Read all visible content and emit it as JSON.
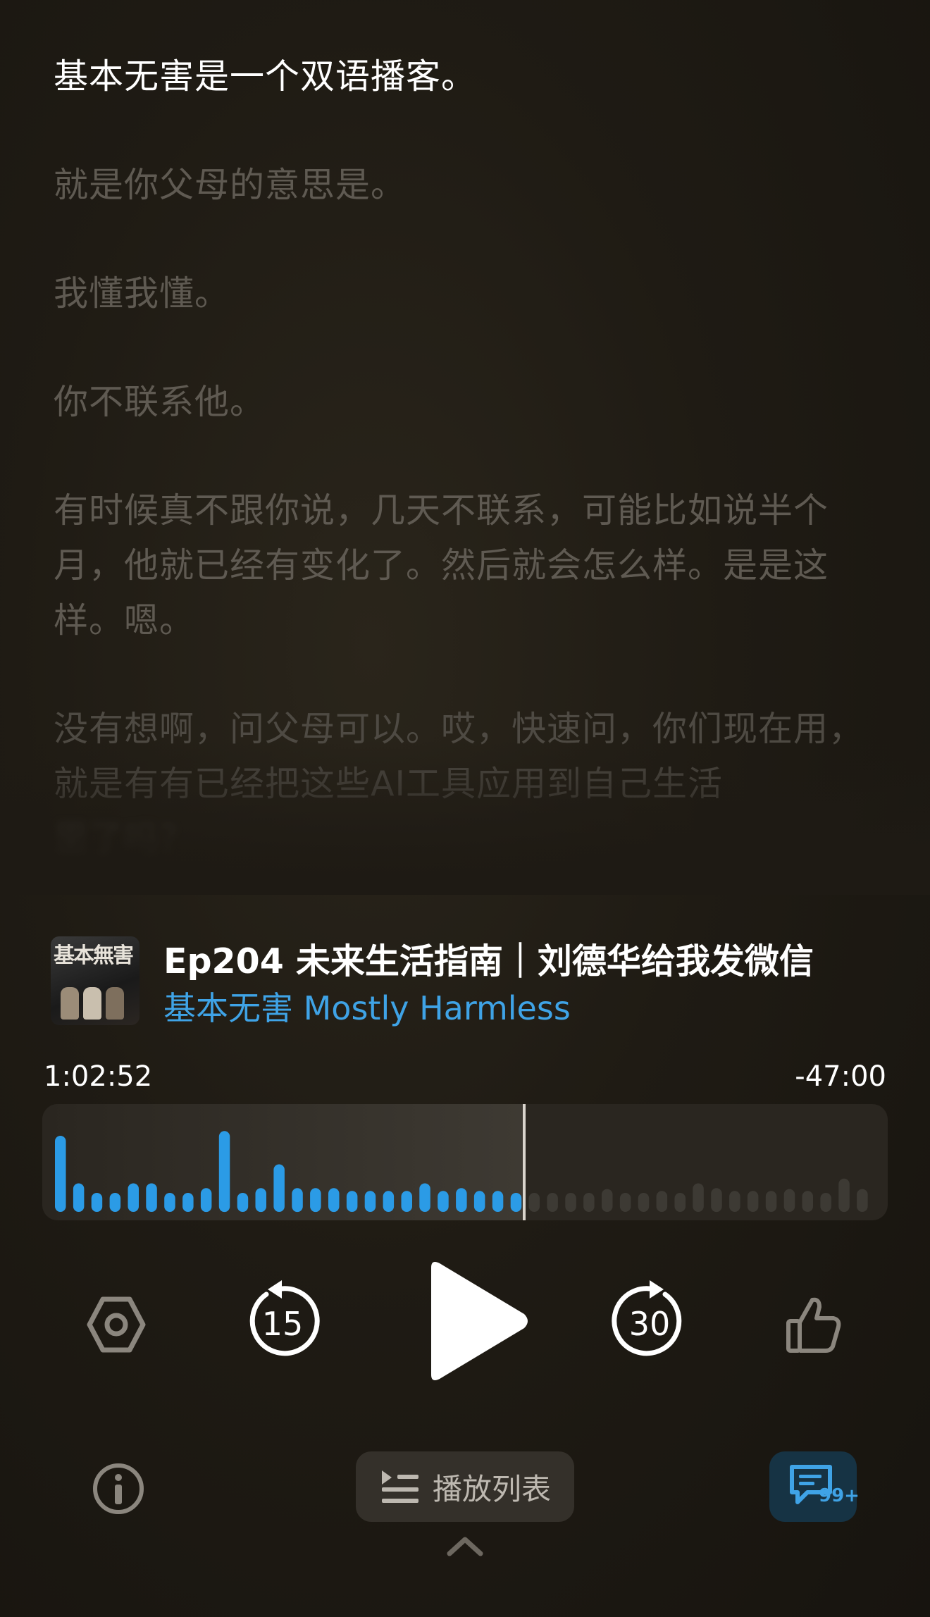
{
  "transcript": [
    {
      "text": "基本无害是一个双语播客。",
      "state": "active"
    },
    {
      "text": "就是你父母的意思是。",
      "state": "dim"
    },
    {
      "text": "我懂我懂。",
      "state": "dim"
    },
    {
      "text": "你不联系他。",
      "state": "dim"
    },
    {
      "text": "有时候真不跟你说，几天不联系，可能比如说半个月，他就已经有变化了。然后就会怎么样。是是这样。嗯。",
      "state": "dim"
    },
    {
      "text": "没有想啊，问父母可以。哎，快速问，你们现在用，就是有有已经把这些AI工具应用到自己生活",
      "state": "fade"
    },
    {
      "text": "里了吗？",
      "state": "blur"
    }
  ],
  "episode": {
    "title": "Ep204 未来生活指南｜刘德华给我发微信",
    "show": "基本无害 Mostly Harmless",
    "cover_text": "基本無害",
    "cover_icon": "podcast-cover-art"
  },
  "player": {
    "elapsed": "1:02:52",
    "remaining": "-47:00",
    "progress_fraction": 0.57,
    "rewind_label": "15",
    "forward_label": "30",
    "accent_color": "#3fa3e6",
    "played_bar_color": "#2b9be6",
    "unplayed_bar_color": "#3d3a34",
    "waveform_levels": [
      0.8,
      0.3,
      0.2,
      0.2,
      0.3,
      0.3,
      0.2,
      0.2,
      0.25,
      0.85,
      0.2,
      0.25,
      0.5,
      0.25,
      0.25,
      0.25,
      0.22,
      0.22,
      0.22,
      0.22,
      0.3,
      0.22,
      0.25,
      0.22,
      0.22,
      0.2,
      0.2,
      0.2,
      0.2,
      0.2,
      0.24,
      0.2,
      0.2,
      0.22,
      0.2,
      0.3,
      0.25,
      0.22,
      0.22,
      0.22,
      0.24,
      0.22,
      0.2,
      0.35,
      0.24
    ]
  },
  "controls": {
    "settings_icon": "hexagon-settings-icon",
    "rewind_icon": "rewind-15-icon",
    "play_icon": "play-icon",
    "forward_icon": "forward-30-icon",
    "like_icon": "thumbs-up-icon"
  },
  "bottom_bar": {
    "info_icon": "info-icon",
    "playlist_label": "播放列表",
    "playlist_icon": "playlist-icon",
    "comments_icon": "comment-icon",
    "comments_badge": "99+",
    "expand_icon": "chevron-up-icon"
  }
}
